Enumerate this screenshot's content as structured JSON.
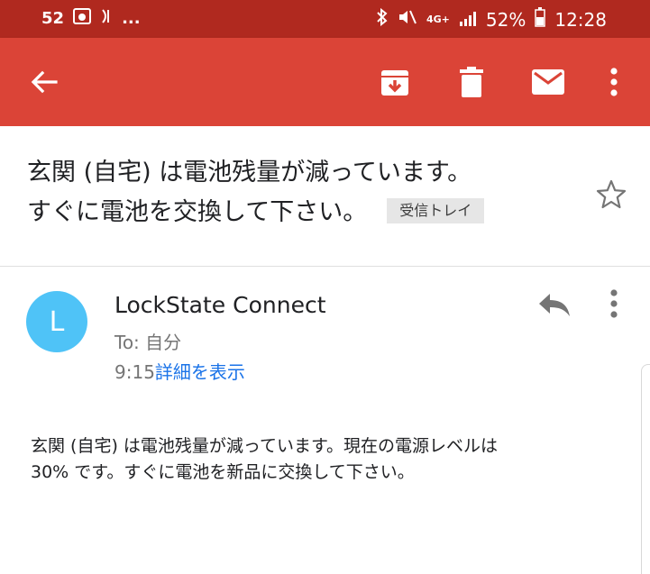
{
  "status_bar": {
    "notification_count": "52",
    "dots": "...",
    "network": "4G+",
    "battery_percent": "52%",
    "time": "12:28"
  },
  "toolbar": {
    "icons": [
      "back-arrow-icon",
      "archive-icon",
      "delete-icon",
      "mark-unread-icon",
      "more-vert-icon"
    ]
  },
  "email": {
    "subject_line1": "玄関 (自宅) は電池残量が減っています。",
    "subject_line2": "すぐに電池を交換して下さい。",
    "label": "受信トレイ",
    "sender_initial": "L",
    "sender_name": "LockState Connect",
    "to": "To: 自分",
    "time": "9:15",
    "details_link": "詳細を表示",
    "body_line1": "玄関 (自宅) は電池残量が減っています。現在の電源レベルは",
    "body_line2": "30% です。すぐに電池を新品に交換して下さい。"
  },
  "colors": {
    "status_bar": "#b0291f",
    "toolbar": "#db4437",
    "avatar": "#4fc3f7",
    "link": "#1a73e8"
  }
}
